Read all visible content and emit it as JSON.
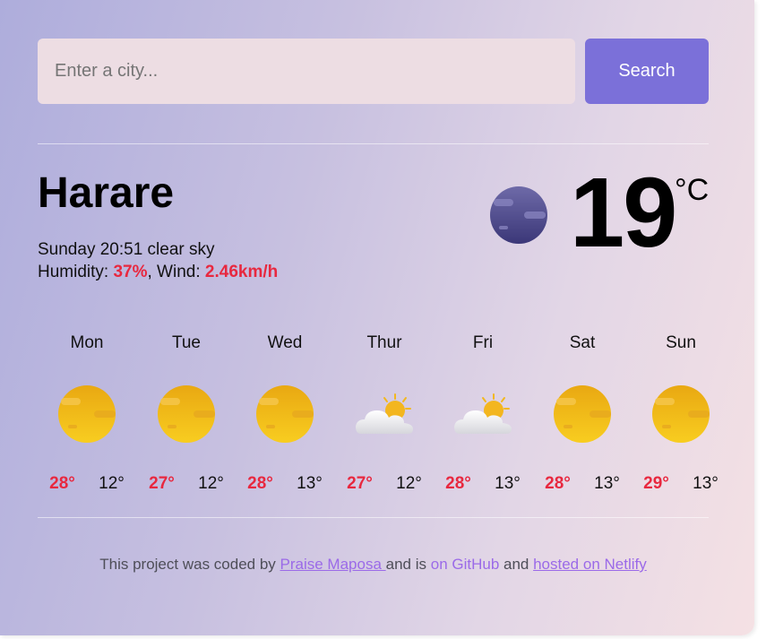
{
  "search": {
    "placeholder": "Enter a city...",
    "button_label": "Search"
  },
  "current": {
    "city": "Harare",
    "day_time": "Sunday 20:51",
    "description": "clear sky",
    "humidity_label": "Humidity: ",
    "humidity_value": "37%",
    "wind_label": ", Wind: ",
    "wind_value": "2.46km/h",
    "temperature": "19",
    "unit": "°C",
    "icon": "night-clear-moon-icon"
  },
  "forecast": [
    {
      "day": "Mon",
      "max": "28°",
      "min": "12°",
      "icon": "sun-icon"
    },
    {
      "day": "Tue",
      "max": "27°",
      "min": "12°",
      "icon": "sun-icon"
    },
    {
      "day": "Wed",
      "max": "28°",
      "min": "13°",
      "icon": "sun-icon"
    },
    {
      "day": "Thur",
      "max": "27°",
      "min": "12°",
      "icon": "partly-cloudy-icon"
    },
    {
      "day": "Fri",
      "max": "28°",
      "min": "13°",
      "icon": "partly-cloudy-icon"
    },
    {
      "day": "Sat",
      "max": "28°",
      "min": "13°",
      "icon": "sun-icon"
    },
    {
      "day": "Sun",
      "max": "29°",
      "min": "13°",
      "icon": "sun-icon"
    }
  ],
  "footer": {
    "text_1": "This project was coded by ",
    "author_link": "Praise Maposa ",
    "text_2": "and is ",
    "github_link": "on GitHub",
    "text_3": " and ",
    "netlify_link": "hosted on Netlify"
  },
  "colors": {
    "accent_button": "#7b70d9",
    "highlight_red": "#e8283f",
    "link_purple": "#9b6ae8",
    "input_background": "#eddde3"
  }
}
